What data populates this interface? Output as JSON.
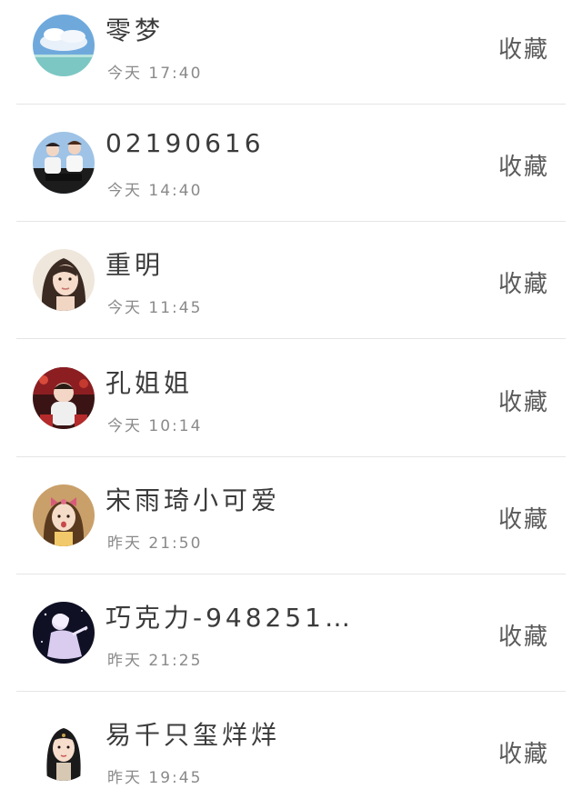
{
  "contacts": [
    {
      "name": "零梦",
      "time": "今天 17:40",
      "action": "收藏",
      "avatar_icon": "sky-sea-avatar"
    },
    {
      "name": "02190616",
      "time": "今天 14:40",
      "action": "收藏",
      "avatar_icon": "two-people-avatar"
    },
    {
      "name": "重明",
      "time": "今天 11:45",
      "action": "收藏",
      "avatar_icon": "woman-portrait-avatar"
    },
    {
      "name": "孔姐姐",
      "time": "今天 10:14",
      "action": "收藏",
      "avatar_icon": "child-avatar"
    },
    {
      "name": "宋雨琦小可爱",
      "time": "昨天 21:50",
      "action": "收藏",
      "avatar_icon": "girl-with-bow-avatar"
    },
    {
      "name": "巧克力-948251…",
      "time": "昨天 21:25",
      "action": "收藏",
      "avatar_icon": "anime-figure-avatar"
    },
    {
      "name": "易千只玺烊烊",
      "time": "昨天 19:45",
      "action": "收藏",
      "avatar_icon": "illustrated-girl-avatar"
    }
  ]
}
